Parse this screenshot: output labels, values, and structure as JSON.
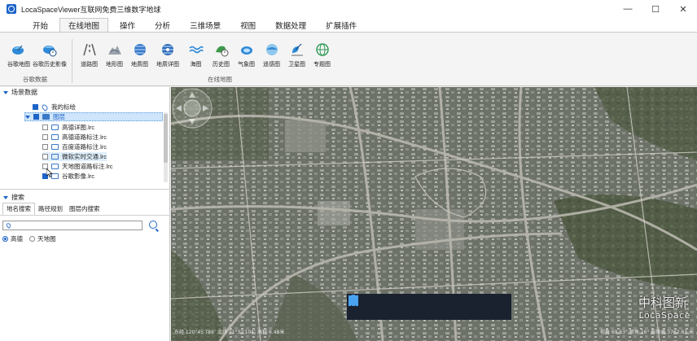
{
  "window": {
    "title": "LocaSpaceViewer互联网免费三维数字地球",
    "minimize": "—",
    "maximize": "☐",
    "close": "✕"
  },
  "menu": {
    "tabs": [
      {
        "label": "开始",
        "active": false
      },
      {
        "label": "在线地图",
        "active": true
      },
      {
        "label": "操作",
        "active": false
      },
      {
        "label": "分析",
        "active": false
      },
      {
        "label": "三维场景",
        "active": false
      },
      {
        "label": "视图",
        "active": false
      },
      {
        "label": "数据处理",
        "active": false
      },
      {
        "label": "扩展插件",
        "active": false
      }
    ]
  },
  "ribbon": {
    "google": {
      "label": "谷歌数据",
      "items": [
        {
          "label": "谷歌地图",
          "icon": "satellite-dish-icon"
        },
        {
          "label": "谷歌历史影像",
          "icon": "history-satellite-icon"
        }
      ]
    },
    "online": {
      "label": "在线地图",
      "items": [
        {
          "label": "道路图",
          "icon": "road-icon"
        },
        {
          "label": "地形图",
          "icon": "terrain-icon"
        },
        {
          "label": "地质图",
          "icon": "geology-icon"
        },
        {
          "label": "地质详图",
          "icon": "geology-detail-icon"
        },
        {
          "label": "海图",
          "icon": "sea-icon"
        },
        {
          "label": "历史图",
          "icon": "history-icon"
        },
        {
          "label": "气象图",
          "icon": "weather-icon"
        },
        {
          "label": "遥感图",
          "icon": "remote-sensing-icon"
        },
        {
          "label": "卫星图",
          "icon": "satellite-icon"
        },
        {
          "label": "专题图",
          "icon": "globe-icon"
        }
      ]
    }
  },
  "scene": {
    "header": "场景数据",
    "items": {
      "mark": "我的标绘",
      "folder": "图层",
      "layer1": "高德详图.lrc",
      "layer2": "高德道路标注.lrc",
      "layer3": "百度道路标注.lrc",
      "layer4": "微软实时交通.lrc",
      "layer5": "天地图道路标注.lrc",
      "layer6": "谷歌影像.lrc"
    }
  },
  "search": {
    "header": "搜索",
    "tabs": [
      "地名搜索",
      "路径规划",
      "图层内搜索"
    ],
    "placeholder": "",
    "value": "",
    "sources": [
      {
        "label": "高德",
        "selected": true
      },
      {
        "label": "天地图",
        "selected": false
      }
    ]
  },
  "map": {
    "status_left": "东经 120°45′789″   北纬 31°32′104″   高程 6.48米",
    "status_right": "视角 69.63° 俯角 16° 影像高 3762.63 米",
    "watermark_cn": "中科图新",
    "watermark_en": "LocaSpace"
  },
  "colors": {
    "accent": "#1e64c8",
    "selection": "#cfe5fb",
    "toolbar_bg": "#1a2230"
  }
}
